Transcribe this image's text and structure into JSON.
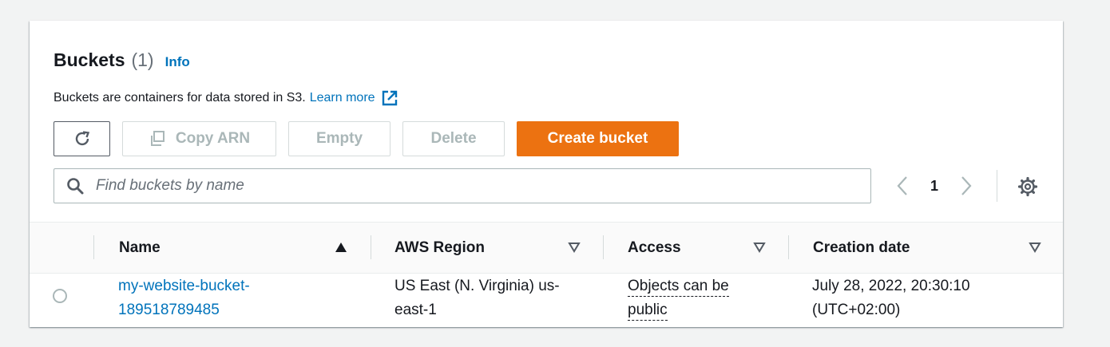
{
  "header": {
    "title": "Buckets",
    "count": "(1)",
    "info_link": "Info",
    "description": "Buckets are containers for data stored in S3.",
    "learn_more": "Learn more"
  },
  "toolbar": {
    "refresh_icon": "refresh-icon",
    "copy_arn": "Copy ARN",
    "empty": "Empty",
    "delete": "Delete",
    "create_bucket": "Create bucket"
  },
  "search": {
    "placeholder": "Find buckets by name",
    "value": ""
  },
  "pagination": {
    "current_page": "1"
  },
  "table": {
    "columns": [
      {
        "label": "Name",
        "sort": "ascending"
      },
      {
        "label": "AWS Region",
        "sort": "none"
      },
      {
        "label": "Access",
        "sort": "none"
      },
      {
        "label": "Creation date",
        "sort": "none"
      }
    ],
    "rows": [
      {
        "name": "my-website-bucket-189518789485",
        "region": "US East (N. Virginia) us-east-1",
        "access": "Objects can be public",
        "creation_date": "July 28, 2022, 20:30:10 (UTC+02:00)",
        "selected": false
      }
    ]
  },
  "colors": {
    "primary_button": "#ec7211",
    "link": "#0073bb",
    "disabled_text": "#aab7b8",
    "page_background": "#f2f3f3"
  }
}
